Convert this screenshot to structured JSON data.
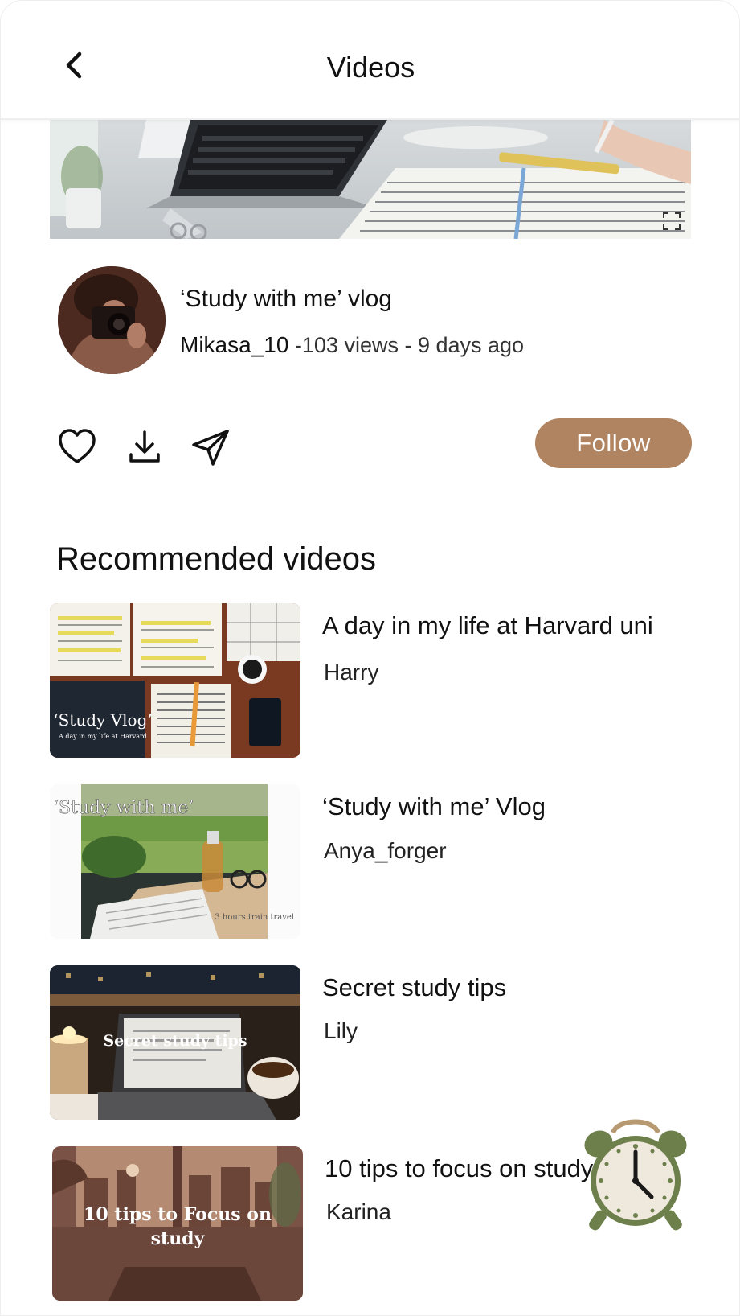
{
  "header": {
    "title": "Videos"
  },
  "current_video": {
    "title": "‘Study with me’ vlog",
    "author": "Mikasa_10",
    "stats": " -103 views - 9 days ago"
  },
  "actions": {
    "follow_label": "Follow"
  },
  "recommended": {
    "heading": "Recommended videos",
    "items": [
      {
        "title": "A day in my life at Harvard uni",
        "author": "Harry",
        "thumb_caption": "‘Study Vlog’",
        "thumb_subcaption": "A day in my life at Harvard"
      },
      {
        "title": "‘Study with me’ Vlog",
        "author": "Anya_forger",
        "thumb_caption": "‘Study with me’",
        "thumb_subcaption": "3 hours train travel"
      },
      {
        "title": "Secret study tips",
        "author": "Lily",
        "thumb_caption": "Secret study tips"
      },
      {
        "title": "10 tips to focus on study",
        "author": "Karina",
        "thumb_caption": "10 tips to Focus on study"
      }
    ]
  },
  "colors": {
    "accent": "#b08461",
    "text": "#111111",
    "background": "#ffffff",
    "clock_green": "#6d7f4a"
  }
}
